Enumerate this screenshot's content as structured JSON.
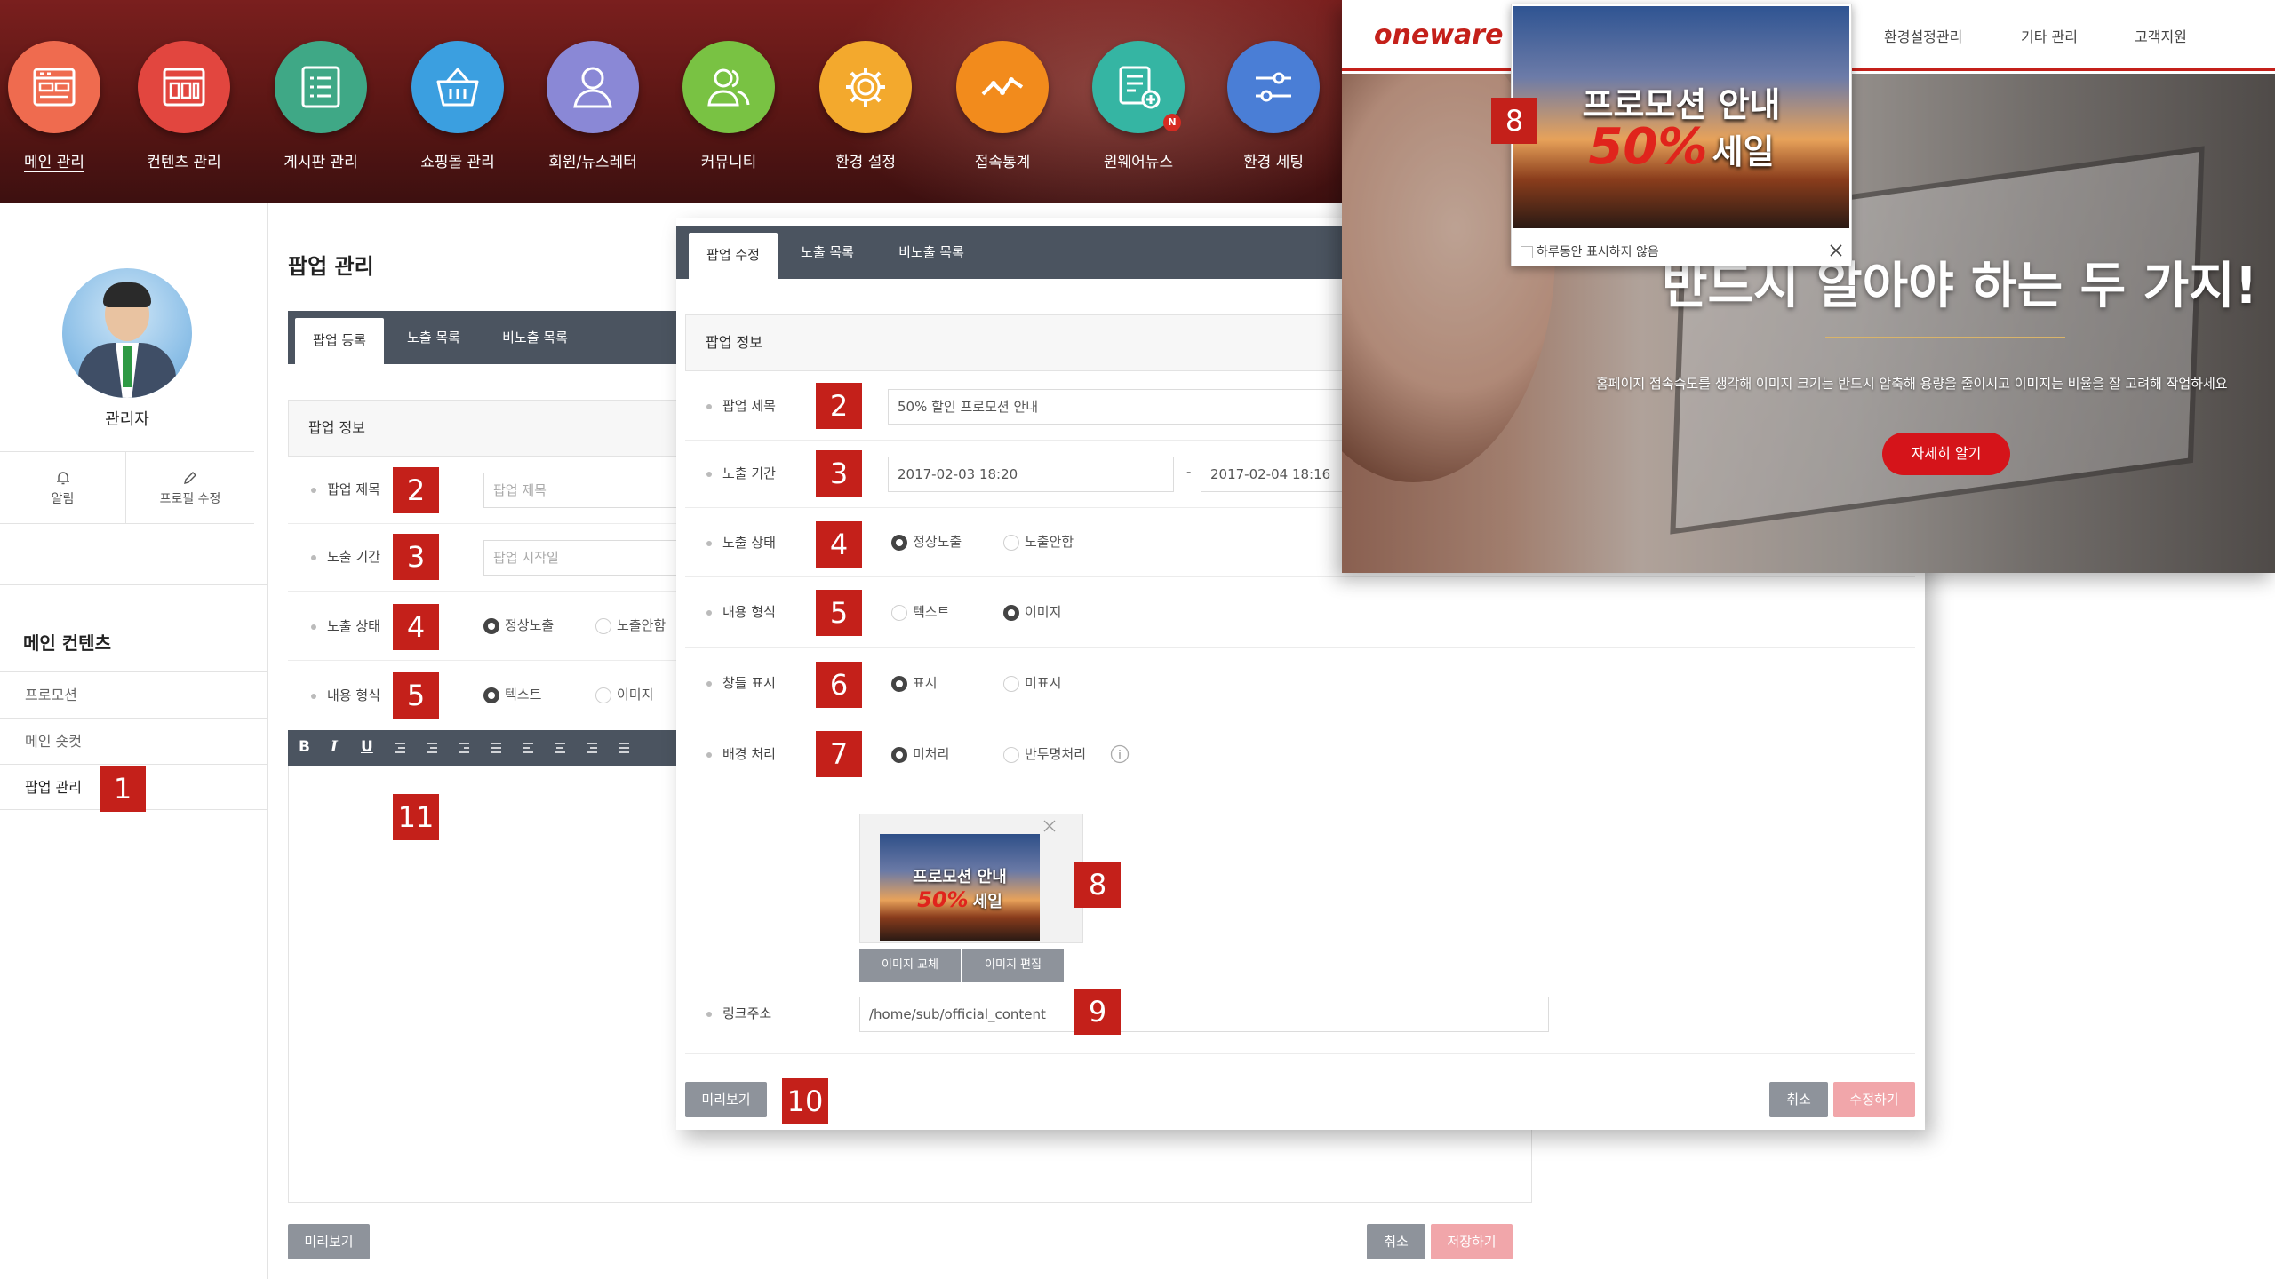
{
  "colors": {
    "accent": "#c4201a",
    "nav_bg": "#5a1614",
    "tab_bg": "#4b5460",
    "save_pink": "#f1a6aa"
  },
  "nav": {
    "items": [
      {
        "label": "메인 관리",
        "icon": "window-grid-icon",
        "color": "#ef6b4f"
      },
      {
        "label": "컨텐츠 관리",
        "icon": "content-blocks-icon",
        "color": "#e2463f"
      },
      {
        "label": "게시판 관리",
        "icon": "list-board-icon",
        "color": "#3fa886"
      },
      {
        "label": "쇼핑몰 관리",
        "icon": "basket-icon",
        "color": "#3b9fe0"
      },
      {
        "label": "회원/뉴스레터",
        "icon": "user-icon",
        "color": "#8a88d6"
      },
      {
        "label": "커뮤니티",
        "icon": "users-icon",
        "color": "#79c243"
      },
      {
        "label": "환경 설정",
        "icon": "gear-icon",
        "color": "#f3a92d"
      },
      {
        "label": "접속통계",
        "icon": "trend-line-icon",
        "color": "#f28b1c"
      },
      {
        "label": "원웨어뉴스",
        "icon": "news-doc-icon",
        "color": "#35b5a3",
        "badge": "N"
      },
      {
        "label": "환경 세팅",
        "icon": "sliders-icon",
        "color": "#4a7ed6"
      }
    ]
  },
  "sidebar": {
    "admin_name": "관리자",
    "alarm_label": "알림",
    "profile_edit_label": "프로필 수정",
    "section_title": "메인 컨텐츠",
    "menu": [
      "프로모션",
      "메인 숏컷",
      "팝업 관리"
    ]
  },
  "badges": [
    "1",
    "2",
    "3",
    "4",
    "5",
    "6",
    "7",
    "8",
    "9",
    "10",
    "11"
  ],
  "register": {
    "title": "팝업 관리",
    "tabs": [
      "팝업 등록",
      "노출 목록",
      "비노출 목록"
    ],
    "section": "팝업 정보",
    "labels": {
      "title": "팝업 제목",
      "period": "노출 기간",
      "status": "노출 상태",
      "format": "내용 형식"
    },
    "placeholders": {
      "title": "팝업 제목",
      "start": "팝업 시작일"
    },
    "status_options": [
      "정상노출",
      "노출안함"
    ],
    "format_options": [
      "텍스트",
      "이미지"
    ],
    "toolbar": [
      "B",
      "I",
      "U"
    ],
    "preview_btn": "미리보기",
    "cancel_btn": "취소",
    "save_btn": "저장하기"
  },
  "edit": {
    "tabs": [
      "팝업 수정",
      "노출 목록",
      "비노출 목록"
    ],
    "section": "팝업 정보",
    "labels": {
      "title": "팝업 제목",
      "period": "노출 기간",
      "status": "노출 상태",
      "format": "내용 형식",
      "frame": "창틀 표시",
      "background": "배경 처리",
      "link": "링크주소"
    },
    "title_value": "50% 할인 프로모션 안내",
    "start_value": "2017-02-03 18:20",
    "period_sep": "-",
    "end_value": "2017-02-04 18:16",
    "status_options": [
      "정상노출",
      "노출안함"
    ],
    "format_options": [
      "텍스트",
      "이미지"
    ],
    "frame_options": [
      "표시",
      "미표시"
    ],
    "background_options": [
      "미처리",
      "반투명처리"
    ],
    "thumb_line1": "프로모션 안내",
    "thumb_sale_pct": "50%",
    "thumb_sale_word": "세일",
    "replace_image_btn": "이미지 교체",
    "edit_image_btn": "이미지 편집",
    "link_value": "/home/sub/official_content",
    "preview_btn": "미리보기",
    "cancel_btn": "취소",
    "save_btn": "수정하기"
  },
  "site": {
    "logo": "oneware",
    "nav": [
      "환경설정관리",
      "기타 관리",
      "고객지원"
    ],
    "popup_line1": "프로모션 안내",
    "popup_sale_pct": "50%",
    "popup_sale_word": "세일",
    "popup_dont_show": "하루동안 표시하지 않음",
    "hero_headline": "반드시 알아야 하는 두 가지!",
    "hero_sub": "홈페이지 접속속도를 생각해 이미지 크기는 반드시 압축해 용량을 줄이시고 이미지는 비율을 잘 고려해 작업하세요",
    "hero_btn": "자세히 알기"
  }
}
